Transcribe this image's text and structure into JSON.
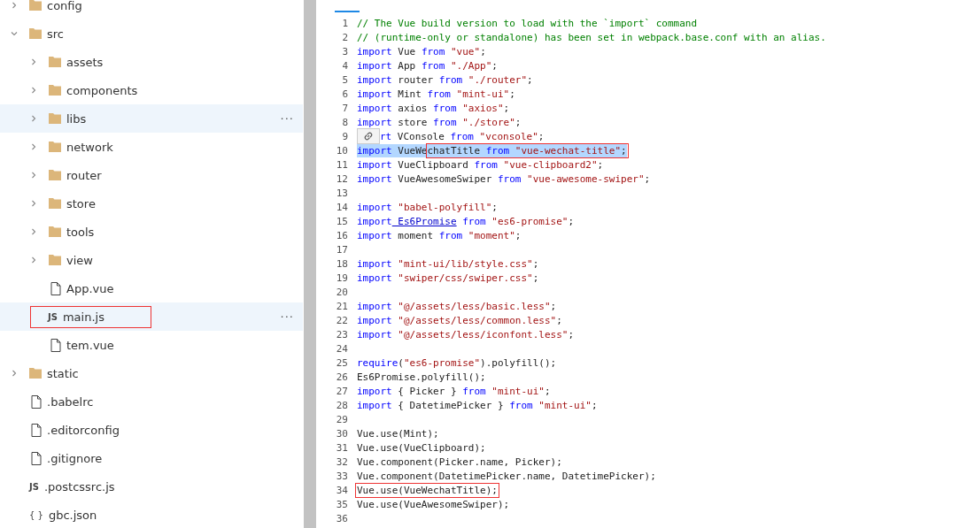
{
  "tree": [
    {
      "name": "config",
      "kind": "folder",
      "expanded": false,
      "highlighted": false,
      "boxed": false
    },
    {
      "name": "src",
      "kind": "folder",
      "expanded": true,
      "highlighted": false,
      "boxed": false,
      "children": [
        {
          "name": "assets",
          "kind": "folder",
          "expanded": false,
          "highlighted": false,
          "boxed": false
        },
        {
          "name": "components",
          "kind": "folder",
          "expanded": false,
          "highlighted": false,
          "boxed": false
        },
        {
          "name": "libs",
          "kind": "folder",
          "expanded": false,
          "highlighted": true,
          "boxed": false,
          "actions": "···"
        },
        {
          "name": "network",
          "kind": "folder",
          "expanded": false,
          "highlighted": false,
          "boxed": false
        },
        {
          "name": "router",
          "kind": "folder",
          "expanded": false,
          "highlighted": false,
          "boxed": false
        },
        {
          "name": "store",
          "kind": "folder",
          "expanded": false,
          "highlighted": false,
          "boxed": false
        },
        {
          "name": "tools",
          "kind": "folder",
          "expanded": false,
          "highlighted": false,
          "boxed": false
        },
        {
          "name": "view",
          "kind": "folder",
          "expanded": false,
          "highlighted": false,
          "boxed": false
        },
        {
          "name": "App.vue",
          "kind": "file",
          "highlighted": false,
          "boxed": false
        },
        {
          "name": "main.js",
          "kind": "js",
          "badge": "JS",
          "highlighted": true,
          "boxed": true,
          "actions": "···"
        },
        {
          "name": "tem.vue",
          "kind": "file",
          "highlighted": false,
          "boxed": false
        }
      ]
    },
    {
      "name": "static",
      "kind": "folder",
      "expanded": false,
      "highlighted": false,
      "boxed": false
    },
    {
      "name": ".babelrc",
      "kind": "file",
      "highlighted": false,
      "boxed": false
    },
    {
      "name": ".editorconfig",
      "kind": "file",
      "highlighted": false,
      "boxed": false
    },
    {
      "name": ".gitignore",
      "kind": "file",
      "highlighted": false,
      "boxed": false
    },
    {
      "name": ".postcssrc.js",
      "kind": "js",
      "badge": "JS",
      "highlighted": false,
      "boxed": false
    },
    {
      "name": "gbc.json",
      "kind": "json",
      "badge": "{ }",
      "highlighted": false,
      "boxed": false
    }
  ],
  "editor": {
    "lines": [
      {
        "n": "1",
        "selected": false,
        "tokens": [
          {
            "cmt": "// The Vue build version to load with the `import` command"
          }
        ]
      },
      {
        "n": "2",
        "selected": false,
        "tokens": [
          {
            "cmt": "// (runtime-only or standalone) has been set in webpack.base.conf with an alias."
          }
        ]
      },
      {
        "n": "3",
        "selected": false,
        "tokens": [
          {
            "kw": "import"
          },
          {
            "pl": " Vue "
          },
          {
            "kw": "from"
          },
          {
            "str": " \"vue\""
          },
          {
            "pl": ";"
          }
        ]
      },
      {
        "n": "4",
        "selected": false,
        "tokens": [
          {
            "kw": "import"
          },
          {
            "pl": " App "
          },
          {
            "kw": "from"
          },
          {
            "str": " \"./App\""
          },
          {
            "pl": ";"
          }
        ]
      },
      {
        "n": "5",
        "selected": false,
        "tokens": [
          {
            "kw": "import"
          },
          {
            "pl": " router "
          },
          {
            "kw": "from"
          },
          {
            "str": " \"./router\""
          },
          {
            "pl": ";"
          }
        ]
      },
      {
        "n": "6",
        "selected": false,
        "tokens": [
          {
            "kw": "import"
          },
          {
            "pl": " Mint "
          },
          {
            "kw": "from"
          },
          {
            "str": " \"mint-ui\""
          },
          {
            "pl": ";"
          }
        ]
      },
      {
        "n": "7",
        "selected": false,
        "tokens": [
          {
            "kw": "import"
          },
          {
            "pl": " axios "
          },
          {
            "kw": "from"
          },
          {
            "str": " \"axios\""
          },
          {
            "pl": ";"
          }
        ]
      },
      {
        "n": "8",
        "selected": false,
        "tokens": [
          {
            "kw": "import"
          },
          {
            "pl": " store "
          },
          {
            "kw": "from"
          },
          {
            "str": " \"./store\""
          },
          {
            "pl": ";"
          }
        ]
      },
      {
        "n": "9",
        "selected": false,
        "popup": true,
        "tokens": [
          {
            "kw": "rt"
          },
          {
            "pl": " VConsole "
          },
          {
            "kw": "from"
          },
          {
            "str": " \"vconsole\""
          },
          {
            "pl": ";"
          }
        ]
      },
      {
        "n": "10",
        "selected": true,
        "tokens": [
          {
            "kw": "import"
          },
          {
            "pl": " VueWe"
          }
        ],
        "boxed": [
          {
            "pl": "chatTitle "
          },
          {
            "kw": "from"
          },
          {
            "str": " \"vue-wechat-title\""
          },
          {
            "pl": ";"
          }
        ]
      },
      {
        "n": "11",
        "selected": false,
        "tokens": [
          {
            "kw": "import"
          },
          {
            "pl": " VueClipboard "
          },
          {
            "kw": "from"
          },
          {
            "str": " \"vue-clipboard2\""
          },
          {
            "pl": ";"
          }
        ]
      },
      {
        "n": "12",
        "selected": false,
        "tokens": [
          {
            "kw": "import"
          },
          {
            "pl": " VueAwesomeSwiper "
          },
          {
            "kw": "from"
          },
          {
            "str": " \"vue-awesome-swiper\""
          },
          {
            "pl": ";"
          }
        ]
      },
      {
        "n": "13"
      },
      {
        "n": "14",
        "selected": false,
        "tokens": [
          {
            "kw": "import"
          },
          {
            "str": " \"babel-polyfill\""
          },
          {
            "pl": ";"
          }
        ]
      },
      {
        "n": "15",
        "selected": false,
        "tokens": [
          {
            "kw": "import"
          },
          {
            "link": " Es6Promise"
          },
          {
            "kw": " from"
          },
          {
            "str": " \"es6-promise\""
          },
          {
            "pl": ";"
          }
        ]
      },
      {
        "n": "16",
        "selected": false,
        "tokens": [
          {
            "kw": "import"
          },
          {
            "pl": " moment "
          },
          {
            "kw": "from"
          },
          {
            "str": " \"moment\""
          },
          {
            "pl": ";"
          }
        ]
      },
      {
        "n": "17"
      },
      {
        "n": "18",
        "selected": false,
        "tokens": [
          {
            "kw": "import"
          },
          {
            "str": " \"mint-ui/lib/style.css\""
          },
          {
            "pl": ";"
          }
        ]
      },
      {
        "n": "19",
        "selected": false,
        "tokens": [
          {
            "kw": "import"
          },
          {
            "str": " \"swiper/css/swiper.css\""
          },
          {
            "pl": ";"
          }
        ]
      },
      {
        "n": "20"
      },
      {
        "n": "21",
        "selected": false,
        "tokens": [
          {
            "kw": "import"
          },
          {
            "str": " \"@/assets/less/basic.less\""
          },
          {
            "pl": ";"
          }
        ]
      },
      {
        "n": "22",
        "selected": false,
        "tokens": [
          {
            "kw": "import"
          },
          {
            "str": " \"@/assets/less/common.less\""
          },
          {
            "pl": ";"
          }
        ]
      },
      {
        "n": "23",
        "selected": false,
        "tokens": [
          {
            "kw": "import"
          },
          {
            "str": " \"@/assets/less/iconfont.less\""
          },
          {
            "pl": ";"
          }
        ]
      },
      {
        "n": "24"
      },
      {
        "n": "25",
        "selected": false,
        "tokens": [
          {
            "kw": "require"
          },
          {
            "pl": "("
          },
          {
            "str": "\"es6-promise\""
          },
          {
            "pl": ").polyfill();"
          }
        ]
      },
      {
        "n": "26",
        "selected": false,
        "tokens": [
          {
            "pl": "Es6Promise.polyfill();"
          }
        ]
      },
      {
        "n": "27",
        "selected": false,
        "tokens": [
          {
            "kw": "import"
          },
          {
            "pl": " { Picker } "
          },
          {
            "kw": "from"
          },
          {
            "str": " \"mint-ui\""
          },
          {
            "pl": ";"
          }
        ]
      },
      {
        "n": "28",
        "selected": false,
        "tokens": [
          {
            "kw": "import"
          },
          {
            "pl": " { DatetimePicker } "
          },
          {
            "kw": "from"
          },
          {
            "str": " \"mint-ui\""
          },
          {
            "pl": ";"
          }
        ]
      },
      {
        "n": "29"
      },
      {
        "n": "30",
        "selected": false,
        "tokens": [
          {
            "pl": "Vue.use(Mint);"
          }
        ]
      },
      {
        "n": "31",
        "selected": false,
        "tokens": [
          {
            "pl": "Vue.use(VueClipboard);"
          }
        ]
      },
      {
        "n": "32",
        "selected": false,
        "tokens": [
          {
            "pl": "Vue.component(Picker.name, Picker);"
          }
        ]
      },
      {
        "n": "33",
        "selected": false,
        "tokens": [
          {
            "pl": "Vue.component(DatetimePicker.name, DatetimePicker);"
          }
        ]
      },
      {
        "n": "34",
        "selected": false,
        "boxed": [
          {
            "pl": "Vue.use(VueWechatTitle);"
          }
        ]
      },
      {
        "n": "35",
        "selected": false,
        "tokens": [
          {
            "pl": "Vue.use(VueAwesomeSwiper);"
          }
        ]
      },
      {
        "n": "36"
      }
    ]
  }
}
